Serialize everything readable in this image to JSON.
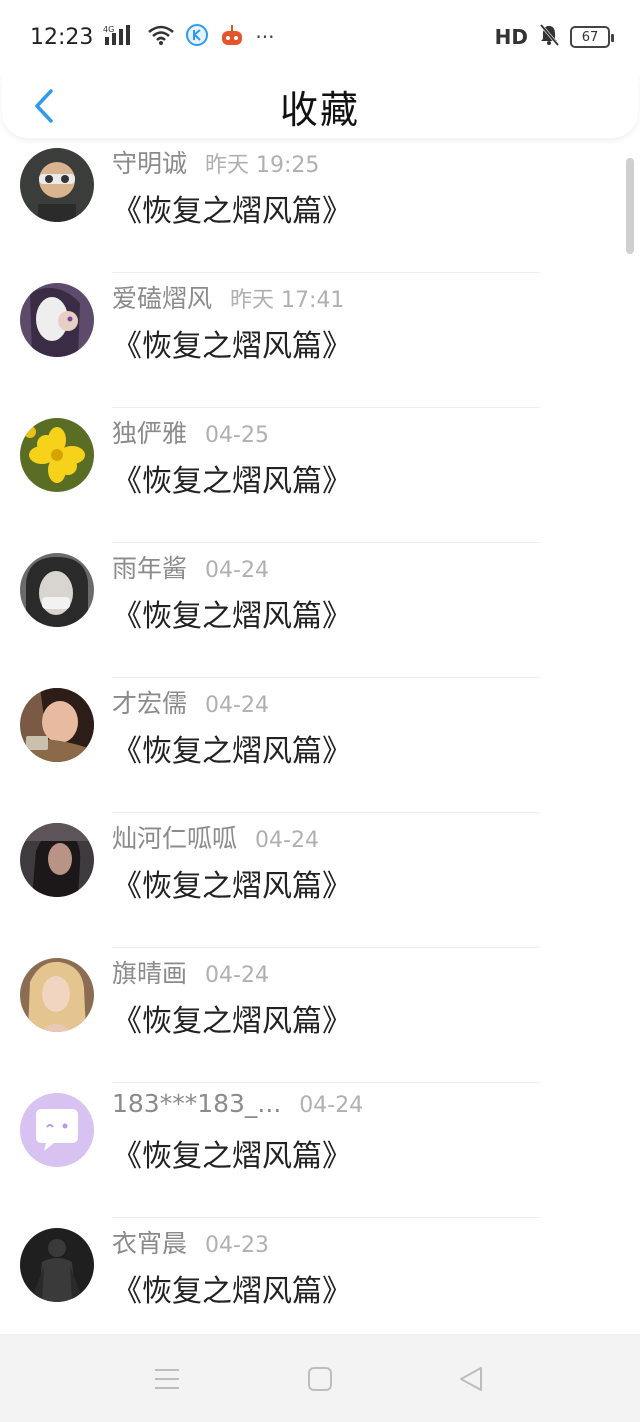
{
  "status_bar": {
    "time": "12:23",
    "signal_label": "4G",
    "dots": "···",
    "hd": "HD",
    "battery": "67"
  },
  "header": {
    "title": "收藏"
  },
  "items": [
    {
      "name": "守明诚",
      "date": "昨天 19:25",
      "book": "《恢复之熠风篇》",
      "avatar_color": "#3a3d3a"
    },
    {
      "name": "爱磕熠风",
      "date": "昨天 17:41",
      "book": "《恢复之熠风篇》",
      "avatar_color": "#5d4b6b"
    },
    {
      "name": "独俨雅",
      "date": "04-25",
      "book": "《恢复之熠风篇》",
      "avatar_color": "#5a6d24"
    },
    {
      "name": "雨年酱",
      "date": "04-24",
      "book": "《恢复之熠风篇》",
      "avatar_color": "#6b6b6b"
    },
    {
      "name": "才宏儒",
      "date": "04-24",
      "book": "《恢复之熠风篇》",
      "avatar_color": "#7a5a45"
    },
    {
      "name": "灿河仁呱呱",
      "date": "04-24",
      "book": "《恢复之熠风篇》",
      "avatar_color": "#3f3a3e"
    },
    {
      "name": "旗晴画",
      "date": "04-24",
      "book": "《恢复之熠风篇》",
      "avatar_color": "#b89266"
    },
    {
      "name": "183***183_...",
      "date": "04-24",
      "book": "《恢复之熠风篇》",
      "avatar_color": "#d8c2f1"
    },
    {
      "name": "衣宵晨",
      "date": "04-23",
      "book": "《恢复之熠风篇》",
      "avatar_color": "#1f1f1f"
    }
  ],
  "colors": {
    "accent": "#2f9bf0",
    "name_gray": "#8b8b8b",
    "date_gray": "#b0b0b0"
  }
}
